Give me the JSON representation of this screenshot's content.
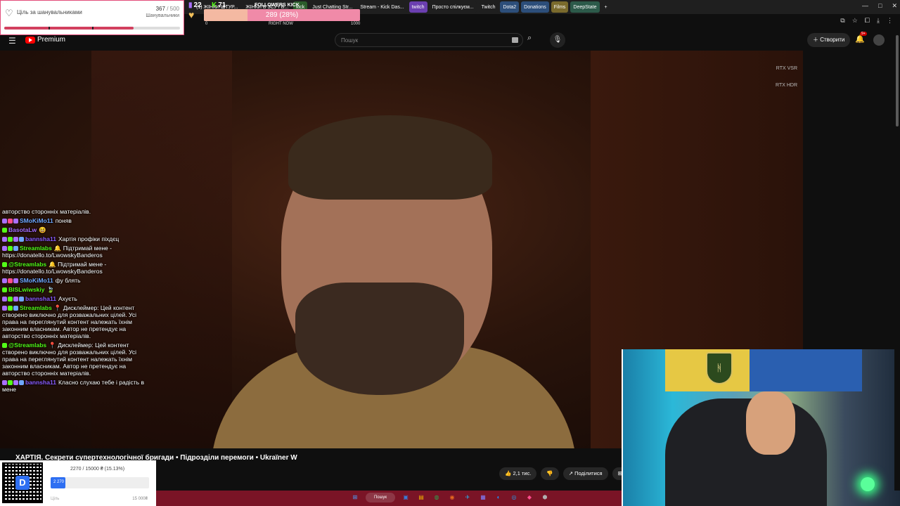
{
  "browser": {
    "tabs": [
      {
        "label": "",
        "color": "#1f1f1f"
      },
      {
        "label": "(1) ЖІНКИ ШТУР...",
        "color": "#1f1f1f"
      },
      {
        "label": "ЖІНКИ В ЗСУ / Б...",
        "color": "#1f1f1f"
      },
      {
        "label": "kick",
        "color": "#2b5d2b"
      },
      {
        "label": "Just Chatting Str...",
        "color": "#1f1f1f"
      },
      {
        "label": "Stream - Kick Das...",
        "color": "#1f1f1f"
      },
      {
        "label": "twitch",
        "color": "#6b3fb0"
      },
      {
        "label": "Просто спілкуєм...",
        "color": "#1f1f1f"
      },
      {
        "label": "Twitch",
        "color": "#1f1f1f"
      },
      {
        "label": "Dota2",
        "color": "#2c4e7a"
      },
      {
        "label": "Donations",
        "color": "#2c4e7a"
      },
      {
        "label": "Films",
        "color": "#7a6a2c"
      },
      {
        "label": "DeepState",
        "color": "#2c5a4a"
      },
      {
        "label": "+",
        "color": "#1f1f1f"
      }
    ],
    "window_controls": [
      "—",
      "□",
      "✕"
    ]
  },
  "goal_widget": {
    "title": "Ціль за шанувальниками",
    "current": "367",
    "max": "/ 500",
    "subtitle": "Шанувальники",
    "progress": 0.734
  },
  "kick_strip": {
    "twitch_count": "22",
    "kick_count": "71",
    "title": "FOLLOWERS KICK",
    "progress_text": "289 (28%)",
    "progress": 0.28,
    "min_label": "0",
    "now_label": "RIGHT NOW",
    "max_label": "1000"
  },
  "youtube": {
    "logo_text": "Premium",
    "search_placeholder": "Пошук",
    "create_label": "Створити",
    "notif_badge": "9+"
  },
  "video": {
    "rtx1": "RTX VSR",
    "rtx2": "RTX HDR",
    "title": "ХАРТІЯ. Секрети супертехнологічної бригади • Підрозділи перемоги • Ukraїner W",
    "likes": "2,1 тис.",
    "share_label": "Поділитися"
  },
  "chat": [
    {
      "user": "",
      "text": "авторство сторонніх матеріалів.",
      "color": "#ffffff",
      "badges": []
    },
    {
      "user": "SMoKiMo11",
      "text": "поняв",
      "color": "#6fa8ff",
      "badges": [
        "#a970ff",
        "#ff4d8d",
        "#a970ff"
      ]
    },
    {
      "user": "BasotaLw",
      "text": "😆",
      "color": "#a970ff",
      "badges": [
        "#53fc18"
      ]
    },
    {
      "user": "bannsha11",
      "text": "Хартія профіки піхдєц",
      "color": "#8a5cff",
      "badges": [
        "#a970ff",
        "#53fc18",
        "#a970ff",
        "#6fa8ff"
      ]
    },
    {
      "user": "Streamlabs",
      "text": "🔔 Підтримай мене - https://donatello.to/LwowskyBanderos",
      "color": "#53fc18",
      "badges": [
        "#a970ff",
        "#53fc18",
        "#6fa8ff"
      ]
    },
    {
      "user": "@Streamlabs",
      "text": "🔔 Підтримай мене - https://donatello.to/LwowskyBanderos",
      "color": "#53fc18",
      "badges": [
        "#53fc18"
      ]
    },
    {
      "user": "SMoKiMo11",
      "text": "фу блять",
      "color": "#6fa8ff",
      "badges": [
        "#a970ff",
        "#ff4d8d",
        "#a970ff"
      ]
    },
    {
      "user": "BISLwiwskiy",
      "text": "🍃",
      "color": "#53fc18",
      "badges": [
        "#53fc18"
      ]
    },
    {
      "user": "bannsha11",
      "text": "Ахуєть",
      "color": "#8a5cff",
      "badges": [
        "#a970ff",
        "#53fc18",
        "#a970ff",
        "#6fa8ff"
      ]
    },
    {
      "user": "Streamlabs",
      "text": "📍 Дисклеймер: Цей контент створено виключно для розважальних цілей. Усі права на переглянутий контент належать їхнім законним власникам. Автор не претендує на авторство сторонніх матеріалів.",
      "color": "#53fc18",
      "badges": [
        "#a970ff",
        "#53fc18",
        "#6fa8ff"
      ]
    },
    {
      "user": "@Streamlabs",
      "text": "📍 Дисклеймер: Цей контент створено виключно для розважальних цілей. Усі права на переглянутий контент належать їхнім законним власникам. Автор не претендує на авторство сторонніх матеріалів.",
      "color": "#53fc18",
      "badges": [
        "#53fc18"
      ]
    },
    {
      "user": "bannsha11",
      "text": "Класно слухаю тебе і радість в мене",
      "color": "#8a5cff",
      "badges": [
        "#a970ff",
        "#53fc18",
        "#a970ff",
        "#6fa8ff"
      ]
    }
  ],
  "donation": {
    "amount_text": "2270 / 15000 ₴ (15.13%)",
    "bar_text": "2 270",
    "progress": 0.1513,
    "goal_label": "Ціль",
    "goal_max": "15 000₴"
  },
  "taskbar": {
    "search_label": "Пошук",
    "apps": [
      "⊞",
      "▣",
      "▤",
      "◍",
      "◉",
      "✈",
      "▦",
      "◐",
      "◎",
      "◆",
      "⬢"
    ]
  }
}
